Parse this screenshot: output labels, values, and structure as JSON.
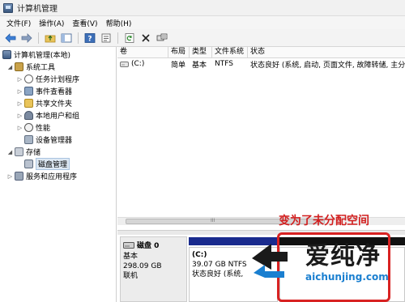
{
  "window": {
    "title": "计算机管理"
  },
  "menu": [
    "文件(F)",
    "操作(A)",
    "查看(V)",
    "帮助(H)"
  ],
  "tree": {
    "root": "计算机管理(本地)",
    "system_tools": "系统工具",
    "task_scheduler": "任务计划程序",
    "event_viewer": "事件查看器",
    "shared_folders": "共享文件夹",
    "local_users": "本地用户和组",
    "performance": "性能",
    "device_manager": "设备管理器",
    "storage": "存储",
    "disk_management": "磁盘管理",
    "services_apps": "服务和应用程序"
  },
  "columns": [
    "卷",
    "布局",
    "类型",
    "文件系统",
    "状态"
  ],
  "volume_row": {
    "volume": "(C:)",
    "layout": "简单",
    "type": "基本",
    "fs": "NTFS",
    "status": "状态良好 (系统, 启动, 页面文件, 故障转储, 主分区)"
  },
  "disk": {
    "name": "磁盘 0",
    "type": "基本",
    "size": "298.09 GB",
    "status": "联机"
  },
  "partition_c": {
    "label": "(C:)",
    "size": "39.07 GB NTFS",
    "status": "状态良好 (系统,"
  },
  "annotation": "变为了未分配空间",
  "watermark": {
    "text": "爱纯净",
    "url": "aichunjing.com"
  },
  "colors": {
    "partition_primary": "#1a2b8e",
    "unallocated": "#111111",
    "annotation": "#d22020"
  }
}
